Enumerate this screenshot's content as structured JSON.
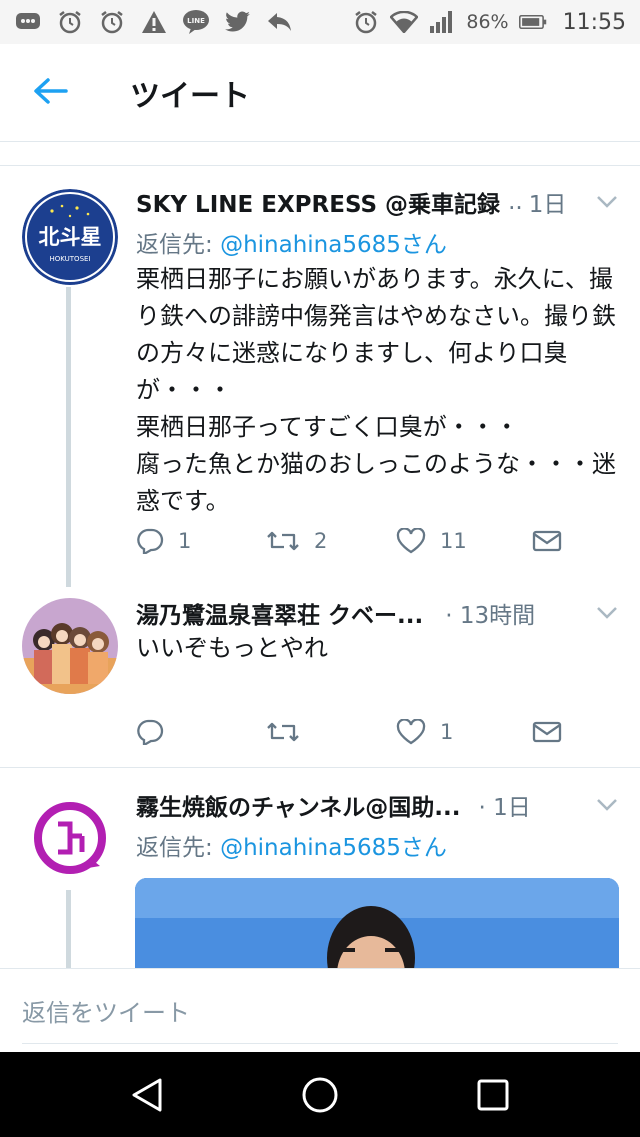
{
  "status_bar": {
    "battery_percent": "86%",
    "time": "11:55",
    "icons": [
      "chat-icon",
      "alarm-icon",
      "alarm-icon",
      "warning-icon",
      "line-icon",
      "twitter-icon",
      "reply-icon",
      "alarm-icon",
      "wifi-icon",
      "signal-icon",
      "battery-icon"
    ],
    "line_label": "LINE"
  },
  "header": {
    "title": "ツイート",
    "back_icon": "arrow-left-icon"
  },
  "tweets": [
    {
      "name": "SKY LINE EXPRESS @乗車記録",
      "ellipsis": "..",
      "time": "1日",
      "reply_to_label": "返信先:",
      "reply_to_handle": "@hinahina5685さん",
      "text": "栗栖日那子にお願いがあります。永久に、撮り鉄への誹謗中傷発言はやめなさい。撮り鉄の方々に迷惑になりますし、何より口臭が・・・\n栗栖日那子ってすごく口臭が・・・\n腐った魚とか猫のおしっこのような・・・迷惑です。",
      "replies": "1",
      "retweets": "2",
      "likes": "11",
      "avatar_text": "北斗星",
      "avatar_subtext": "HOKUTOSEI"
    },
    {
      "name": "湯乃鷺温泉喜翠荘 クベー...",
      "time": "· 13時間",
      "text": "いいぞもっとやれ",
      "replies": "",
      "retweets": "",
      "likes": "1"
    },
    {
      "name": "霧生焼飯のチャンネル@国助...",
      "time": "· 1日",
      "reply_to_label": "返信先:",
      "reply_to_handle": "@hinahina5685さん"
    }
  ],
  "composer": {
    "placeholder": "返信をツイート"
  },
  "colors": {
    "accent": "#1da1f2",
    "mention": "#1b95e0",
    "muted": "#657786"
  }
}
